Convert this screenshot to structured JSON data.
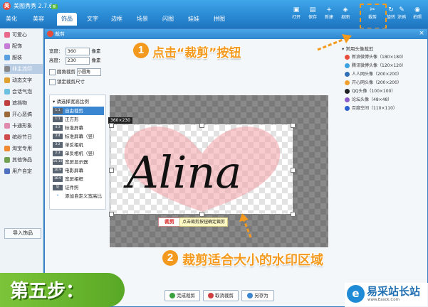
{
  "app": {
    "name": "美图秀秀 2.7.6",
    "logo": "美"
  },
  "tabs": [
    {
      "label": "美化",
      "x": 0
    },
    {
      "label": "美容",
      "x": 0
    },
    {
      "label": "饰品",
      "x": 0
    },
    {
      "label": "文字",
      "x": 0
    },
    {
      "label": "边框",
      "x": 0
    },
    {
      "label": "场景",
      "x": 0
    },
    {
      "label": "闪图",
      "x": 0
    },
    {
      "label": "娃娃",
      "x": 0
    },
    {
      "label": "拼图",
      "x": 0
    }
  ],
  "tab_badge": "新",
  "toolbar": {
    "open": "打开",
    "save": "保存",
    "new": "新建",
    "crop_tool": "抠图",
    "crop": "裁剪",
    "rotate": "旋转",
    "doodle": "涂鸦",
    "shoot": "拍照"
  },
  "sidebar": {
    "items": [
      "可爱心",
      "配饰",
      "服装",
      "非主流印",
      "动态文字",
      "会话气泡",
      "遮挡物",
      "开心恶搞",
      "卡通形象",
      "缤纷节日",
      "淘宝专用",
      "其他饰品",
      "用户自定"
    ],
    "import_label": "导入饰品"
  },
  "dialog": {
    "title": "裁剪",
    "close": "×",
    "width_label": "宽度：",
    "width_value": "360",
    "height_label": "高度：",
    "height_value": "230",
    "unit": "像素",
    "rounded_label": "圆角裁剪",
    "rounded_select": "小圆角",
    "lock_label": "锁定裁剪尺寸",
    "ratio_title": "请选择宽高比例",
    "ratios": [
      {
        "tag": "1:1",
        "label": "自由裁剪"
      },
      {
        "tag": "1:1",
        "label": "正方形"
      },
      {
        "tag": "4:3",
        "label": "标准屏幕"
      },
      {
        "tag": "3:4",
        "label": "标准屏幕（竖）"
      },
      {
        "tag": "3:2",
        "label": "单反相机"
      },
      {
        "tag": "2:3",
        "label": "单反相机（竖）"
      },
      {
        "tag": "16:10",
        "label": "宽屏显示器"
      },
      {
        "tag": "16:9",
        "label": "电影屏幕"
      },
      {
        "tag": "16:9",
        "label": "宽屏相框"
      },
      {
        "tag": "证",
        "label": "证件照"
      },
      {
        "tag": "+",
        "label": "添加自定义宽高比"
      }
    ],
    "size_tag": "360×230",
    "watermark_text": "Alina",
    "crop_button": "裁剪",
    "crop_tip": "点击裁剪按钮确定裁剪",
    "preset_title": "常用头像裁剪",
    "presets": [
      "新浪微博头像（180×180）",
      "腾讯微博头像（120×120）",
      "人人网头像（200×200）",
      "开心网头像（200×200）",
      "QQ头像（100×100）",
      "论坛头像（48×48）",
      "百度空间（110×110）"
    ],
    "buttons": {
      "finish": "完成裁剪",
      "cancel": "取消裁剪",
      "save_as": "另存为"
    }
  },
  "annotations": {
    "step1_num": "1",
    "step1_text": "点击“裁剪”按钮",
    "step2_num": "2",
    "step2_text": "裁剪适合大小的水印区域",
    "step_banner": "第五步："
  },
  "brand": {
    "mark": "e",
    "name": "易采站长站",
    "url": "www.Easck.Com"
  },
  "colors": {
    "accent": "#f39a1e",
    "title_blue": "#2f86cf",
    "green": "#7cc43a"
  }
}
